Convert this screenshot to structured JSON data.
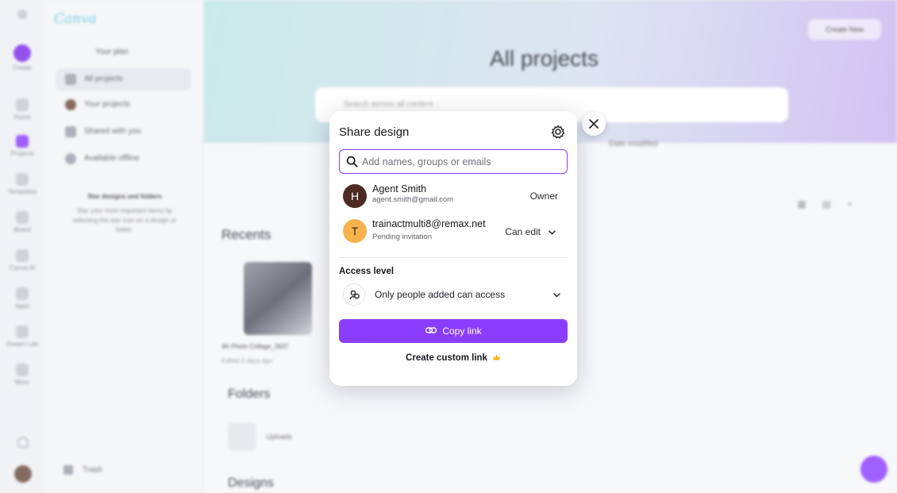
{
  "background": {
    "logo": "Canva",
    "rail": [
      {
        "label": "Create"
      },
      {
        "label": "Home"
      },
      {
        "label": "Projects"
      },
      {
        "label": "Templates"
      },
      {
        "label": "Brand"
      },
      {
        "label": "Canva AI"
      },
      {
        "label": "Apps"
      },
      {
        "label": "Dream Lab"
      },
      {
        "label": "More"
      }
    ],
    "sidebar": {
      "plan": "Your plan",
      "items": [
        {
          "label": "All projects"
        },
        {
          "label": "Your projects"
        },
        {
          "label": "Shared with you"
        },
        {
          "label": "Available offline"
        }
      ],
      "promo_title": "Star designs and folders",
      "promo_text": "Star your most important items by selecting the star icon on a design or folder.",
      "trash": "Trash"
    },
    "main": {
      "title": "All projects",
      "new_folder": "Create New",
      "search_placeholder": "Search across all content",
      "sort_label": "Date modified",
      "recents": "Recents",
      "recent_item_name": "4K Photo Collage_2637",
      "recent_item_sub": "Edited 2 days ago",
      "folders": "Folders",
      "uploads": "Uploads",
      "designs": "Designs"
    }
  },
  "modal": {
    "title": "Share design",
    "search_placeholder": "Add names, groups or emails",
    "people": [
      {
        "initial": "H",
        "name": "Agent Smith",
        "sub": "agent.smith@gmail.com",
        "role": "Owner"
      },
      {
        "initial": "T",
        "name": "trainactmulti8@remax.net",
        "sub": "Pending invitation",
        "role": "Can edit"
      }
    ],
    "access_label": "Access level",
    "access_value": "Only people added can access",
    "copy_link": "Copy link",
    "custom_link": "Create custom link"
  },
  "colors": {
    "accent": "#8b3dff",
    "owner_avatar": "#4d2b23",
    "pending_avatar": "#f7b24c",
    "crown": "#f5b400"
  },
  "icons": [
    "settings-gear-icon",
    "close-icon",
    "search-icon",
    "chevron-down-icon",
    "people-group-icon",
    "link-icon",
    "crown-icon"
  ]
}
